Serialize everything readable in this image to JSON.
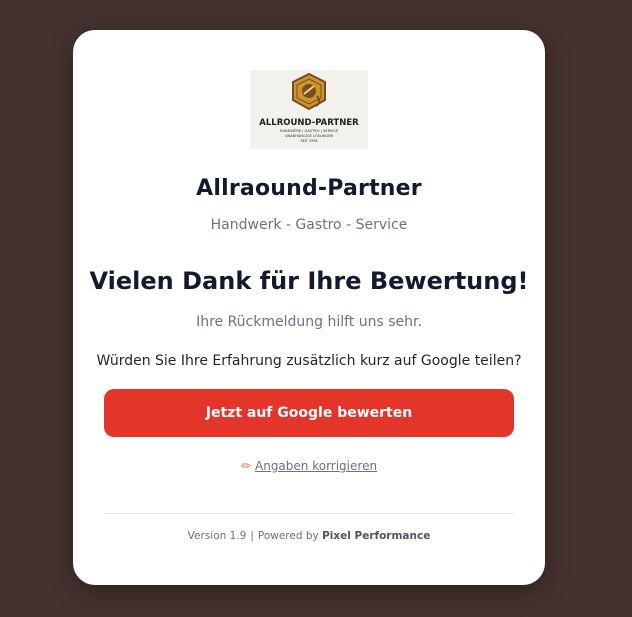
{
  "logo": {
    "text": "ALLROUND-PARTNER",
    "line1": "HANDWERK | GASTRO | SERVICE",
    "line2": "UNABHÄNGIGE LÖSUNGEN",
    "line3": "SEIT 1996",
    "colors": {
      "gold": "#c9952c",
      "brown": "#7a4a22"
    }
  },
  "brand": {
    "name": "Allraound-Partner",
    "tagline": "Handwerk - Gastro - Service"
  },
  "thanks": {
    "title": "Vielen Dank für Ihre Bewertung!",
    "subtitle": "Ihre Rückmeldung hilft uns sehr."
  },
  "question": "Würden Sie Ihre Erfahrung zusätzlich kurz auf Google teilen?",
  "google_button": {
    "label": "Jetzt auf Google bewerten",
    "color": "#e3352a"
  },
  "edit_link": {
    "icon": "pencil-icon",
    "label": "Angaben korrigieren"
  },
  "footer": {
    "version": "Version 1.9",
    "separator": "|",
    "powered_by": "Powered by",
    "company": "Pixel Performance"
  },
  "colors": {
    "background": "#45322e",
    "card": "#ffffff",
    "text_dark": "#141a2e",
    "text_muted": "#6b7280"
  }
}
